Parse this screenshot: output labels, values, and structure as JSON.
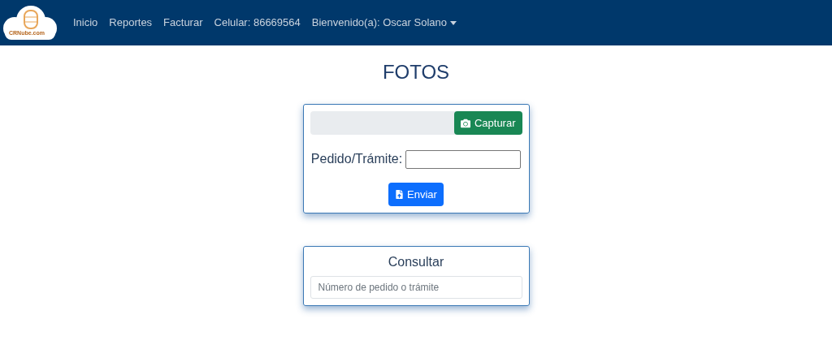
{
  "navbar": {
    "logo_text": "CRNube.com",
    "links": [
      {
        "label": "Inicio",
        "kind": "link"
      },
      {
        "label": "Reportes",
        "kind": "link"
      },
      {
        "label": "Facturar",
        "kind": "link"
      },
      {
        "label": "Celular: 86669564",
        "kind": "link"
      },
      {
        "label": "Bienvenido(a): Oscar Solano",
        "kind": "dropdown"
      }
    ]
  },
  "title": "FOTOS",
  "upload_card": {
    "capture_button": "Capturar",
    "field_label": "Pedido/Trámite:",
    "send_button": "Enviar"
  },
  "query_card": {
    "title": "Consultar",
    "placeholder": "Número de pedido o trámite"
  }
}
